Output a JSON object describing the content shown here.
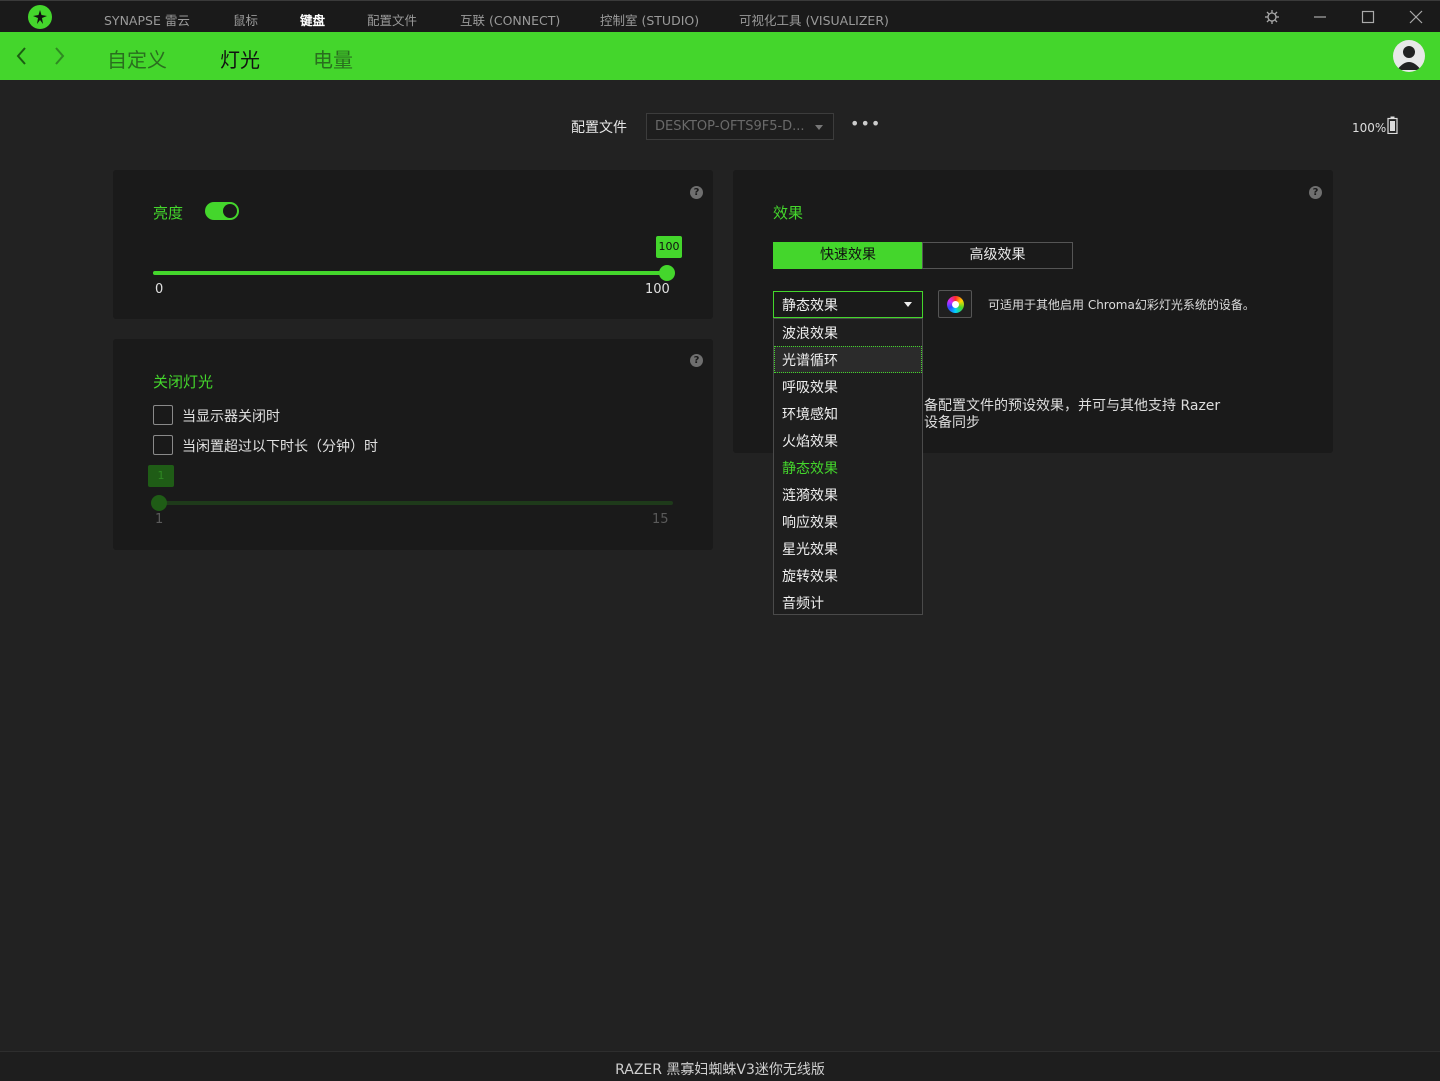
{
  "titlebar": {
    "nav": [
      "SYNAPSE 雷云",
      "鼠标",
      "键盘",
      "配置文件",
      "互联 (CONNECT)",
      "控制室 (STUDIO)",
      "可视化工具 (VISUALIZER)"
    ],
    "active_nav": "键盘"
  },
  "subnav": {
    "tabs": [
      "自定义",
      "灯光",
      "电量"
    ],
    "active_tab": "灯光"
  },
  "profile": {
    "label": "配置文件",
    "value": "DESKTOP-OFTS9F5-D...",
    "more": "•••"
  },
  "battery": {
    "percent_text": "100%"
  },
  "brightness_panel": {
    "title": "亮度",
    "enabled": true,
    "value": 100,
    "value_label": "100",
    "min_label": "0",
    "max_label": "100"
  },
  "lights_off_panel": {
    "title": "关闭灯光",
    "options": [
      {
        "label": "当显示器关闭时",
        "checked": false
      },
      {
        "label": "当闲置超过以下时长（分钟）时",
        "checked": false
      }
    ],
    "idle_value_label": "1",
    "min_label": "1",
    "max_label": "15"
  },
  "effect_panel": {
    "title": "效果",
    "tabs": [
      "快速效果",
      "高级效果"
    ],
    "active_tab": "快速效果",
    "selected_effect": "静态效果",
    "chroma_note": "可适用于其他启用 Chroma幻彩灯光系统的设备。",
    "desc_line1": "备配置文件的预设效果，并可与其他支持 Razer",
    "desc_line2": "设备同步",
    "dropdown_options": [
      "波浪效果",
      "光谱循环",
      "呼吸效果",
      "环境感知",
      "火焰效果",
      "静态效果",
      "涟漪效果",
      "响应效果",
      "星光效果",
      "旋转效果",
      "音频计"
    ],
    "hovered_option": "光谱循环"
  },
  "footer": {
    "device_name": "RAZER 黑寡妇蜘蛛V3迷你无线版"
  },
  "colors": {
    "accent": "#44d62c",
    "background": "#222222",
    "panel": "#1a1a1a"
  }
}
